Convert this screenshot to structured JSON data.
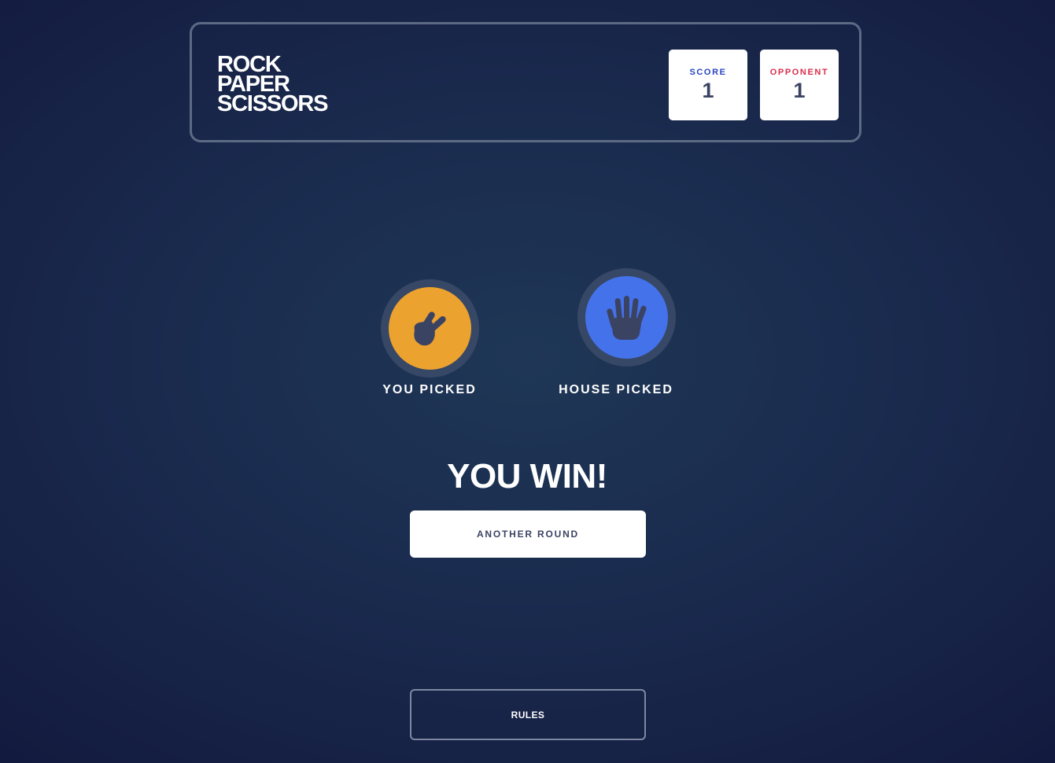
{
  "header": {
    "logo_lines": [
      "ROCK",
      "PAPER",
      "SCISSORS"
    ],
    "score_label": "SCORE",
    "score_value": "1",
    "opponent_label": "OPPONENT",
    "opponent_value": "1"
  },
  "picks": {
    "user": {
      "label": "YOU PICKED",
      "icon": "scissors-icon",
      "color": "#eca22e"
    },
    "house": {
      "label": "HOUSE PICKED",
      "icon": "paper-icon",
      "color": "#4472ea"
    }
  },
  "result": {
    "text": "YOU WIN!",
    "button_label": "ANOTHER ROUND"
  },
  "footer": {
    "rules_label": "RULES"
  },
  "colors": {
    "background": "#1a2b4e",
    "ring": "#374766",
    "dark_text": "#3b4363",
    "score_label": "#2a46c0",
    "opponent_label": "#db2e4d"
  }
}
